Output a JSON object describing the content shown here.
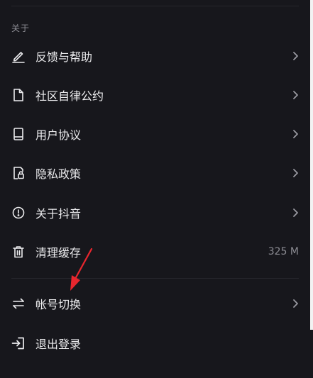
{
  "section": {
    "title": "关于"
  },
  "items": [
    {
      "label": "反馈与帮助",
      "icon": "pencil-icon",
      "chevron": true
    },
    {
      "label": "社区自律公约",
      "icon": "document-icon",
      "chevron": true
    },
    {
      "label": "用户协议",
      "icon": "book-icon",
      "chevron": true
    },
    {
      "label": "隐私政策",
      "icon": "lock-document-icon",
      "chevron": true
    },
    {
      "label": "关于抖音",
      "icon": "info-circle-icon",
      "chevron": true
    },
    {
      "label": "清理缓存",
      "icon": "trash-icon",
      "chevron": false,
      "meta": "325 M"
    }
  ],
  "account_items": [
    {
      "label": "帐号切换",
      "icon": "switch-arrows-icon",
      "chevron": true
    },
    {
      "label": "退出登录",
      "icon": "logout-icon",
      "chevron": false
    }
  ],
  "colors": {
    "background": "#17171c",
    "text": "#ececee",
    "muted": "#8c8c93",
    "annotation_arrow": "#e8262e"
  }
}
